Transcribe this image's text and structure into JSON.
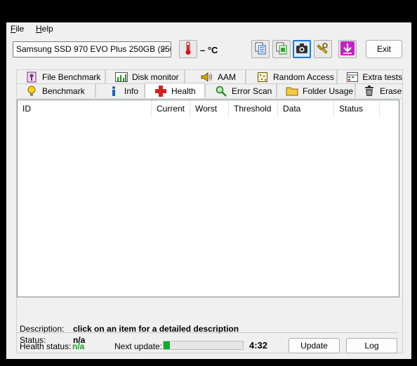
{
  "menu": {
    "file": "File",
    "file_underline": "F",
    "file_rest": "ile",
    "help_underline": "H",
    "help_rest": "elp"
  },
  "toolbar": {
    "drive": "Samsung SSD 970 EVO Plus 250GB (250",
    "temperature": "– °C",
    "exit_label": "Exit"
  },
  "tabs": {
    "row1": [
      "File Benchmark",
      "Disk monitor",
      "AAM",
      "Random Access",
      "Extra tests"
    ],
    "row2": [
      "Benchmark",
      "Info",
      "Health",
      "Error Scan",
      "Folder Usage",
      "Erase"
    ],
    "selected": "Health"
  },
  "table": {
    "columns": [
      "ID",
      "Current",
      "Worst",
      "Threshold",
      "Data",
      "Status"
    ]
  },
  "details": {
    "description_label": "Description:",
    "description_value": "click on an item for a detailed description",
    "status_label": "Status:",
    "status_value": "n/a"
  },
  "footer": {
    "health_label": "Health status:",
    "health_value": "n/a",
    "next_update_label": "Next update:",
    "progress_fraction": 0.08,
    "timer": "4:32",
    "update_label": "Update",
    "log_label": "Log"
  },
  "colors": {
    "accent_progress": "#06b025",
    "health_ok": "#1aa32a",
    "selected_tool_border": "#1e7ad6"
  }
}
